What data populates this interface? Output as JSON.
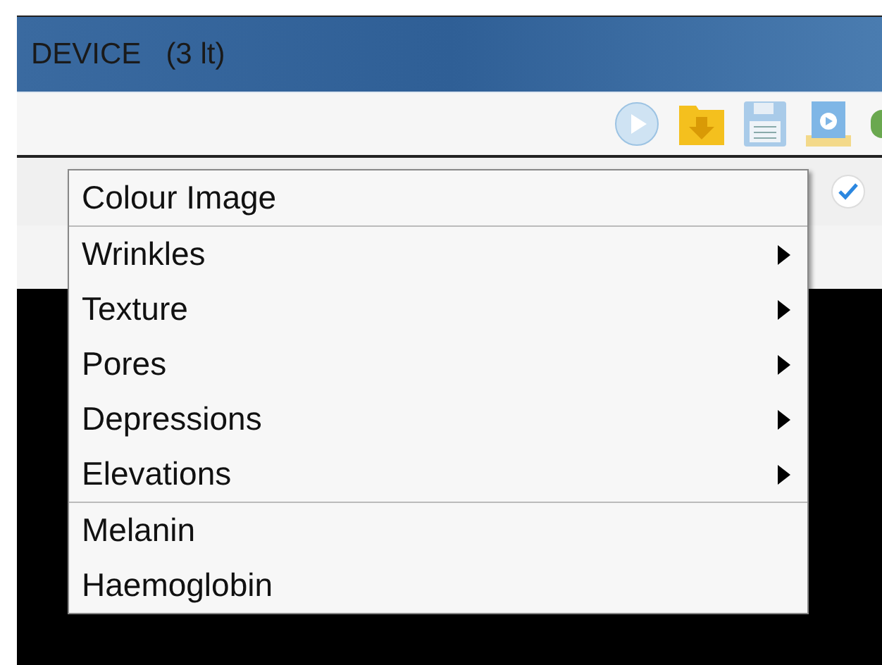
{
  "window": {
    "title": "DEVICE   (3 lt)"
  },
  "options": {
    "checked": true
  },
  "menu": {
    "sections": [
      [
        {
          "label": "Colour Image",
          "kind": "plain"
        }
      ],
      [
        {
          "label": "Wrinkles",
          "kind": "submenu"
        },
        {
          "label": "Texture",
          "kind": "submenu"
        },
        {
          "label": "Pores",
          "kind": "submenu"
        },
        {
          "label": "Depressions",
          "kind": "submenu"
        },
        {
          "label": "Elevations",
          "kind": "submenu"
        }
      ],
      [
        {
          "label": "Melanin",
          "kind": "plain"
        },
        {
          "label": "Haemoglobin",
          "kind": "plain"
        }
      ]
    ]
  }
}
